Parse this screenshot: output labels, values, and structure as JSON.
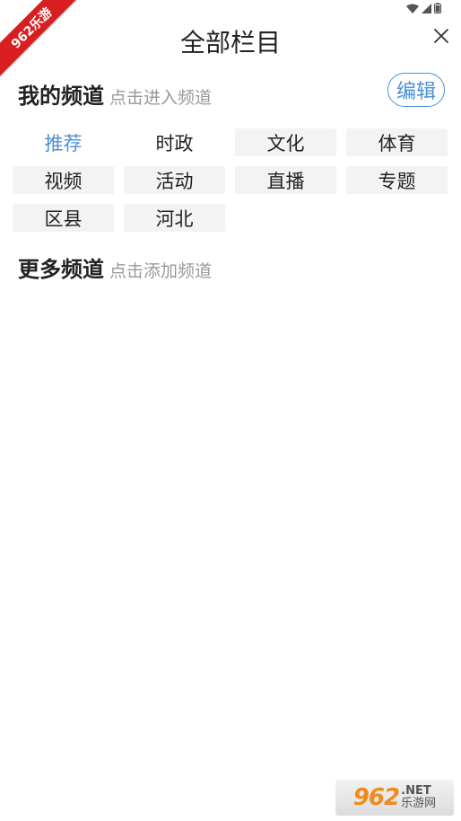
{
  "header": {
    "title": "全部栏目"
  },
  "my_channels": {
    "title": "我的频道",
    "hint": "点击进入频道",
    "edit_label": "编辑",
    "items": [
      {
        "label": "推荐"
      },
      {
        "label": "时政"
      },
      {
        "label": "文化"
      },
      {
        "label": "体育"
      },
      {
        "label": "视频"
      },
      {
        "label": "活动"
      },
      {
        "label": "直播"
      },
      {
        "label": "专题"
      },
      {
        "label": "区县"
      },
      {
        "label": "河北"
      }
    ]
  },
  "more_channels": {
    "title": "更多频道",
    "hint": "点击添加频道"
  },
  "watermarks": {
    "corner": "962乐游",
    "bottom_big": "962",
    "bottom_net": ".NET",
    "bottom_cn": "乐游网"
  },
  "colors": {
    "accent": "#4a90d9",
    "chip_bg": "#f3f3f3",
    "hint": "#999999",
    "ribbon": "#d81e1e"
  }
}
